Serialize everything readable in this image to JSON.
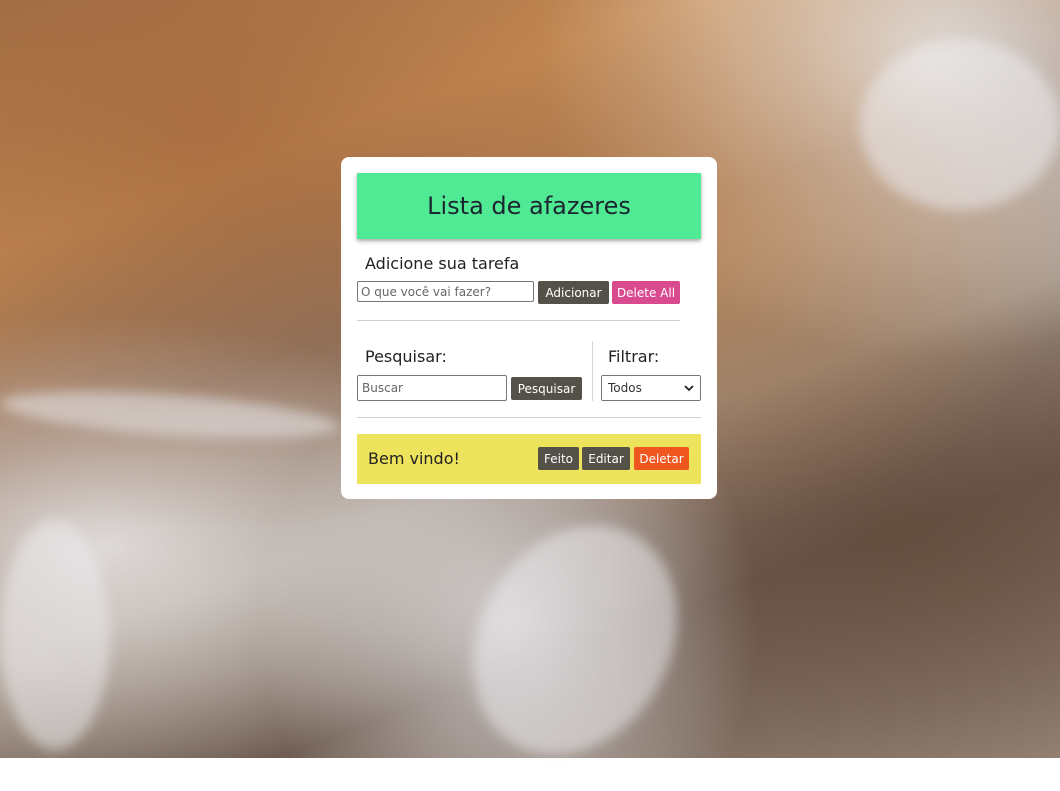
{
  "header": {
    "title": "Lista de afazeres"
  },
  "add": {
    "label": "Adicione sua tarefa",
    "input_placeholder": "O que você vai fazer?",
    "add_button": "Adicionar",
    "delete_all_button": "Delete All"
  },
  "search": {
    "label": "Pesquisar:",
    "input_placeholder": "Buscar",
    "button": "Pesquisar"
  },
  "filter": {
    "label": "Filtrar:",
    "selected": "Todos"
  },
  "todos": [
    {
      "text": "Bem vindo!",
      "done_label": "Feito",
      "edit_label": "Editar",
      "delete_label": "Deletar"
    }
  ],
  "colors": {
    "header_bg": "#4fea93",
    "todo_bg": "#eee35c",
    "dark_button": "#545149",
    "pink_button": "#da4a8f",
    "orange_button": "#ef5620"
  }
}
